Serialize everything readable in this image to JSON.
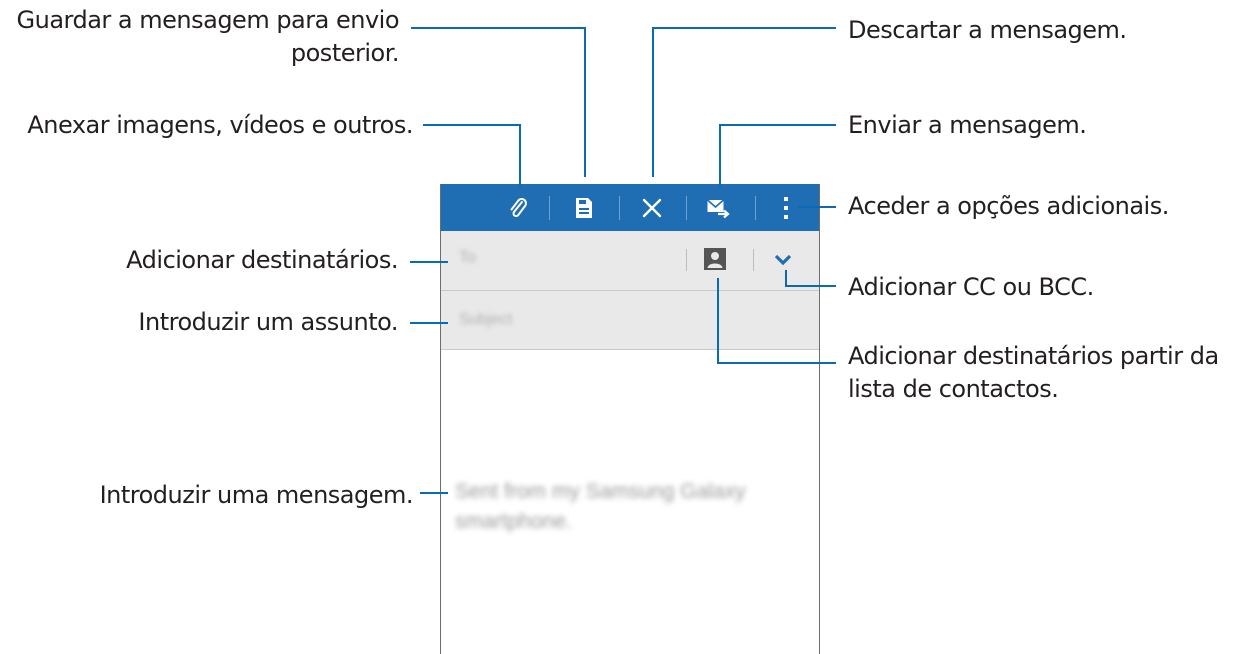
{
  "annotations": {
    "save_draft": "Guardar a mensagem para envio\nposterior.",
    "attach": "Anexar imagens, vídeos e outros.",
    "discard": "Descartar a mensagem.",
    "send": "Enviar a mensagem.",
    "more_options": "Aceder a opções adicionais.",
    "add_recipients": "Adicionar destinatários.",
    "add_cc_bcc": "Adicionar CC ou BCC.",
    "enter_subject": "Introduzir um assunto.",
    "add_from_contacts": "Adicionar destinatários partir da\nlista de contactos.",
    "enter_message": "Introduzir uma mensagem."
  },
  "composer": {
    "to_placeholder": "To",
    "subject_placeholder": "Subject",
    "body_text": "Sent from my Samsung Galaxy smartphone."
  },
  "icons": {
    "attach": "paperclip-icon",
    "save": "save-icon",
    "discard": "close-icon",
    "send": "send-mail-icon",
    "more": "more-vertical-icon",
    "contacts": "contact-icon",
    "expand": "chevron-down-icon"
  },
  "colors": {
    "action_bar": "#1f6eb3",
    "leader_lines": "#0a6bb4",
    "field_background": "#e9e9e9"
  }
}
